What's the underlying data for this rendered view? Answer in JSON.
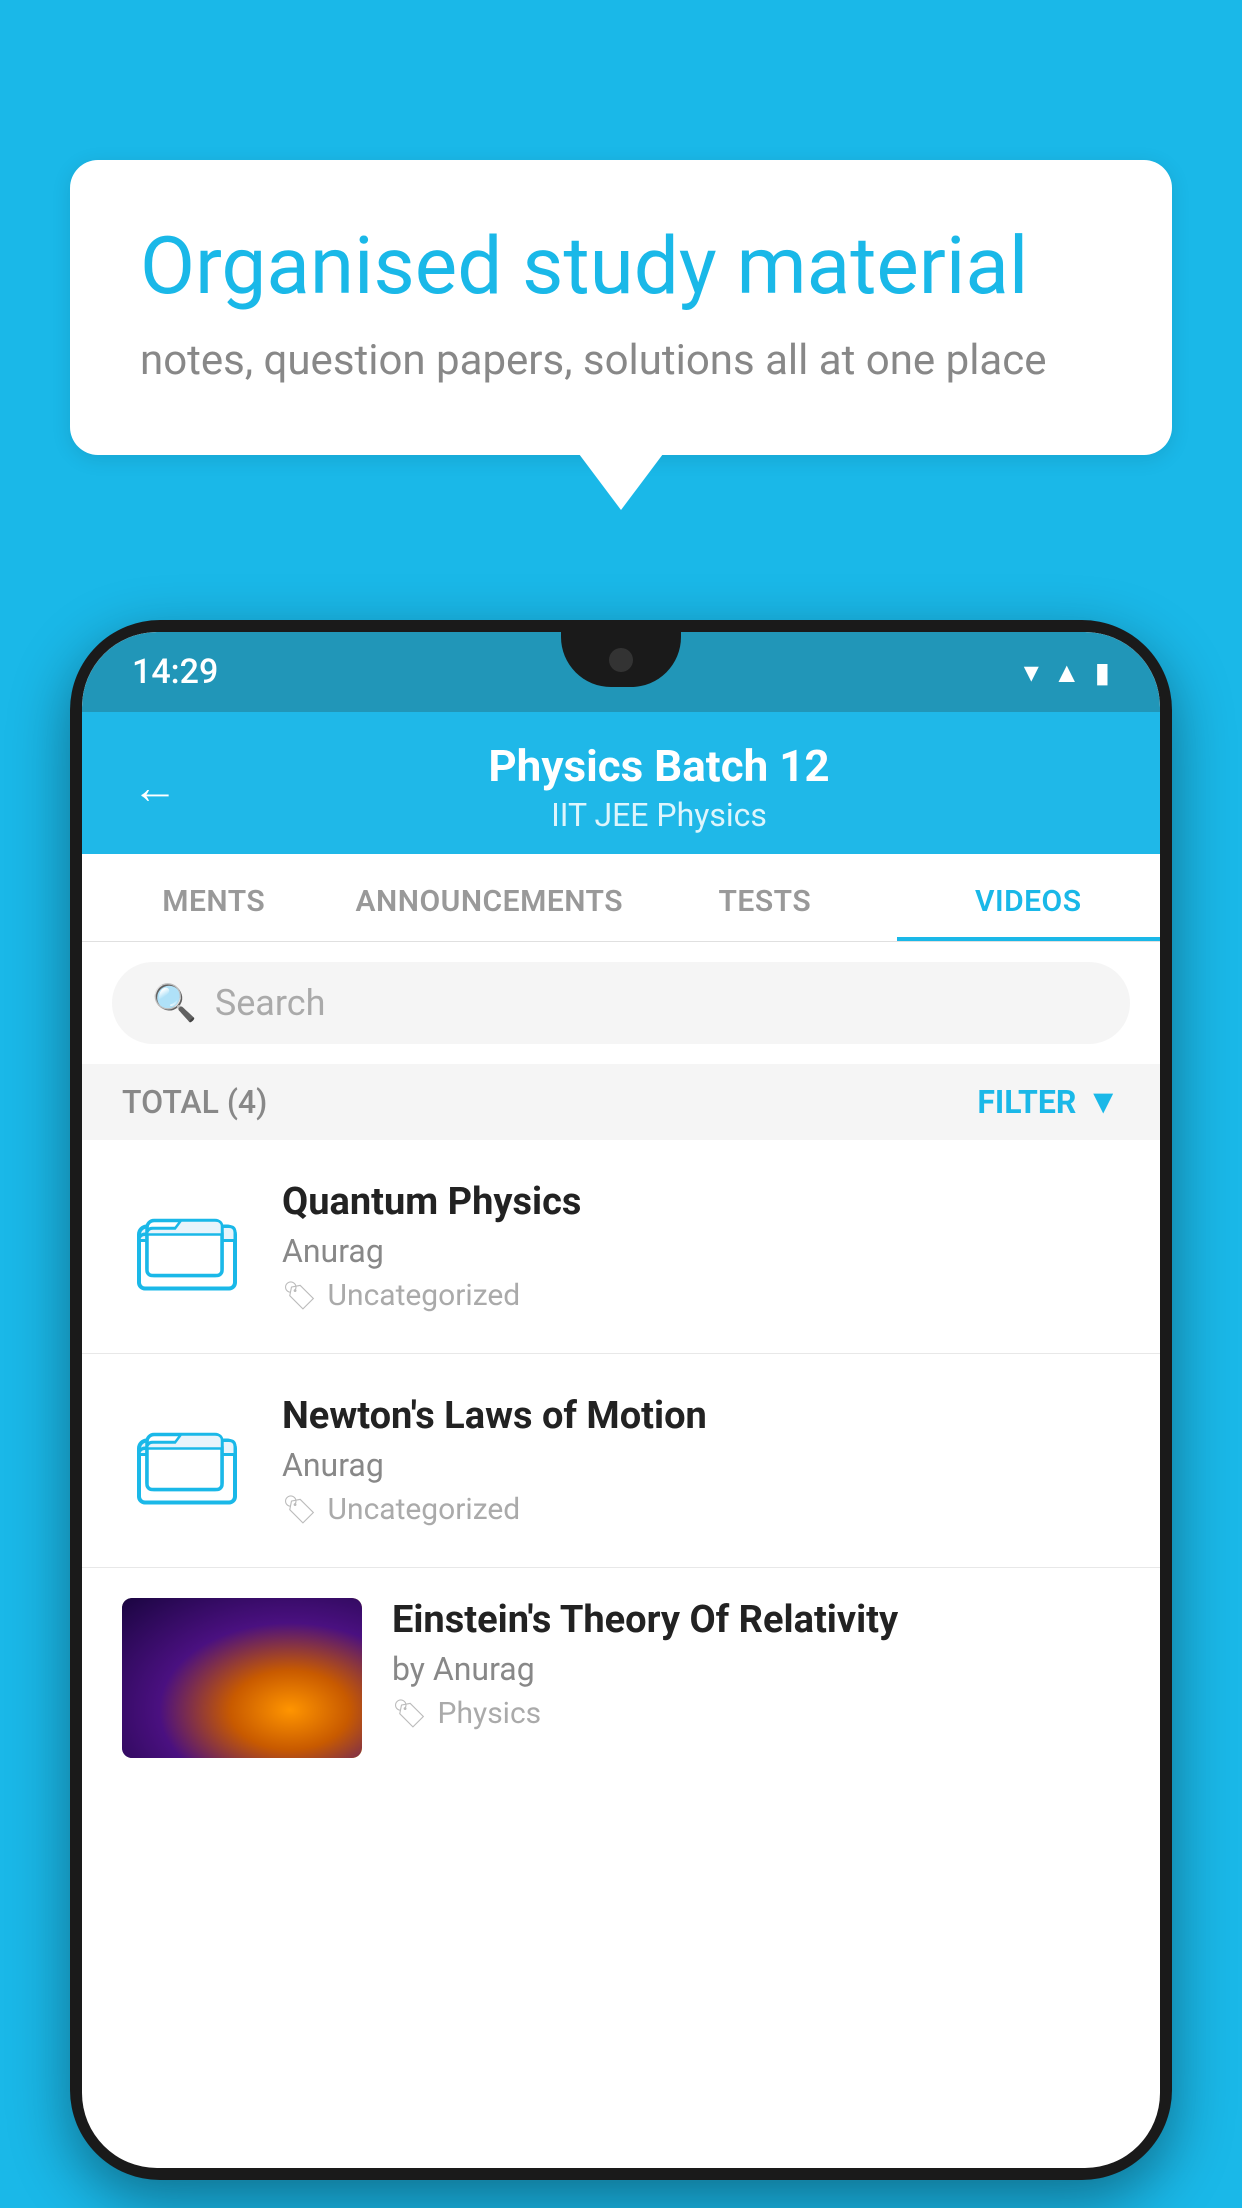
{
  "background_color": "#1ab8e8",
  "speech_bubble": {
    "title": "Organised study material",
    "subtitle": "notes, question papers, solutions all at one place"
  },
  "phone": {
    "status_bar": {
      "time": "14:29"
    },
    "header": {
      "title": "Physics Batch 12",
      "subtitle": "IIT JEE   Physics",
      "back_label": "←"
    },
    "tabs": [
      {
        "label": "MENTS",
        "active": false
      },
      {
        "label": "ANNOUNCEMENTS",
        "active": false
      },
      {
        "label": "TESTS",
        "active": false
      },
      {
        "label": "VIDEOS",
        "active": true
      }
    ],
    "search": {
      "placeholder": "Search"
    },
    "filter_bar": {
      "total_label": "TOTAL (4)",
      "filter_label": "FILTER"
    },
    "videos": [
      {
        "id": 1,
        "title": "Quantum Physics",
        "author": "Anurag",
        "tag": "Uncategorized",
        "type": "folder"
      },
      {
        "id": 2,
        "title": "Newton's Laws of Motion",
        "author": "Anurag",
        "tag": "Uncategorized",
        "type": "folder"
      },
      {
        "id": 3,
        "title": "Einstein's Theory Of Relativity",
        "author": "by Anurag",
        "tag": "Physics",
        "type": "video"
      }
    ]
  }
}
